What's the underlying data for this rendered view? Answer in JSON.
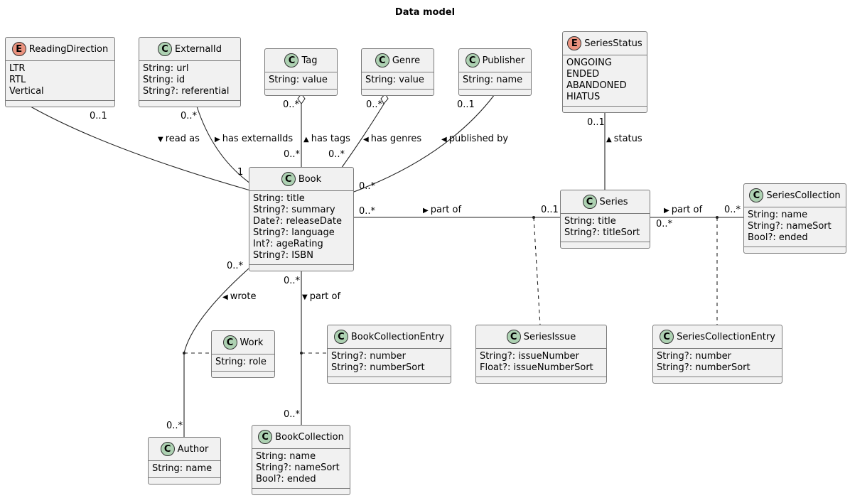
{
  "title": "Data model",
  "classes": {
    "readingDirection": {
      "kind": "E",
      "name": "ReadingDirection",
      "attrs": [
        "LTR",
        "RTL",
        "Vertical"
      ]
    },
    "externalId": {
      "kind": "C",
      "name": "ExternalId",
      "attrs": [
        "String: url",
        "String: id",
        "String?: referential"
      ]
    },
    "tag": {
      "kind": "C",
      "name": "Tag",
      "attrs": [
        "String: value"
      ]
    },
    "genre": {
      "kind": "C",
      "name": "Genre",
      "attrs": [
        "String: value"
      ]
    },
    "publisher": {
      "kind": "C",
      "name": "Publisher",
      "attrs": [
        "String: name"
      ]
    },
    "seriesStatus": {
      "kind": "E",
      "name": "SeriesStatus",
      "attrs": [
        "ONGOING",
        "ENDED",
        "ABANDONED",
        "HIATUS"
      ]
    },
    "book": {
      "kind": "C",
      "name": "Book",
      "attrs": [
        "String: title",
        "String?: summary",
        "Date?: releaseDate",
        "String?: language",
        "Int?: ageRating",
        "String?: ISBN"
      ]
    },
    "series": {
      "kind": "C",
      "name": "Series",
      "attrs": [
        "String: title",
        "String?: titleSort"
      ]
    },
    "seriesCollection": {
      "kind": "C",
      "name": "SeriesCollection",
      "attrs": [
        "String: name",
        "String?: nameSort",
        "Bool?: ended"
      ]
    },
    "work": {
      "kind": "C",
      "name": "Work",
      "attrs": [
        "String: role"
      ]
    },
    "bookCollectionEntry": {
      "kind": "C",
      "name": "BookCollectionEntry",
      "attrs": [
        "String?: number",
        "String?: numberSort"
      ]
    },
    "seriesIssue": {
      "kind": "C",
      "name": "SeriesIssue",
      "attrs": [
        "String?: issueNumber",
        "Float?: issueNumberSort"
      ]
    },
    "seriesCollectionEntry": {
      "kind": "C",
      "name": "SeriesCollectionEntry",
      "attrs": [
        "String?: number",
        "String?: numberSort"
      ]
    },
    "author": {
      "kind": "C",
      "name": "Author",
      "attrs": [
        "String: name"
      ]
    },
    "bookCollection": {
      "kind": "C",
      "name": "BookCollection",
      "attrs": [
        "String: name",
        "String?: nameSort",
        "Bool?: ended"
      ]
    }
  },
  "relations": {
    "readAs": {
      "label": "read as",
      "arrow": "▼",
      "from_mult": "0..1",
      "to_mult": ""
    },
    "hasExternalIds": {
      "label": "has externalIds",
      "arrow": "▶",
      "from_mult": "0..*",
      "to_mult": "1"
    },
    "hasTags": {
      "label": "has tags",
      "arrow": "▲",
      "from_mult": "0..*",
      "to_mult": "0..*"
    },
    "hasGenres": {
      "label": "has genres",
      "arrow": "◀",
      "from_mult": "0..*",
      "to_mult": "0..*"
    },
    "publishedBy": {
      "label": "published by",
      "arrow": "◀",
      "from_mult": "0..1",
      "to_mult": "0..*"
    },
    "status": {
      "label": "status",
      "arrow": "▲",
      "from_mult": "0..1"
    },
    "bookPartOfSeries": {
      "label": "part of",
      "arrow": "▶",
      "from_mult": "0..*",
      "to_mult": "0..1"
    },
    "seriesPartOfCollection": {
      "label": "part of",
      "arrow": "▶",
      "from_mult": "0..*",
      "to_mult": "0..*"
    },
    "wrote": {
      "label": "wrote",
      "arrow": "◀",
      "from_mult": "0..*",
      "to_mult": "0..*"
    },
    "bookPartOfCollection": {
      "label": "part of",
      "arrow": "▼",
      "from_mult": "0..*",
      "to_mult": "0..*"
    }
  },
  "colors": {
    "class_badge": "#add1b2",
    "enum_badge": "#eb937f",
    "box_fill": "#f1f1f1",
    "box_border": "#7a7a7a"
  }
}
